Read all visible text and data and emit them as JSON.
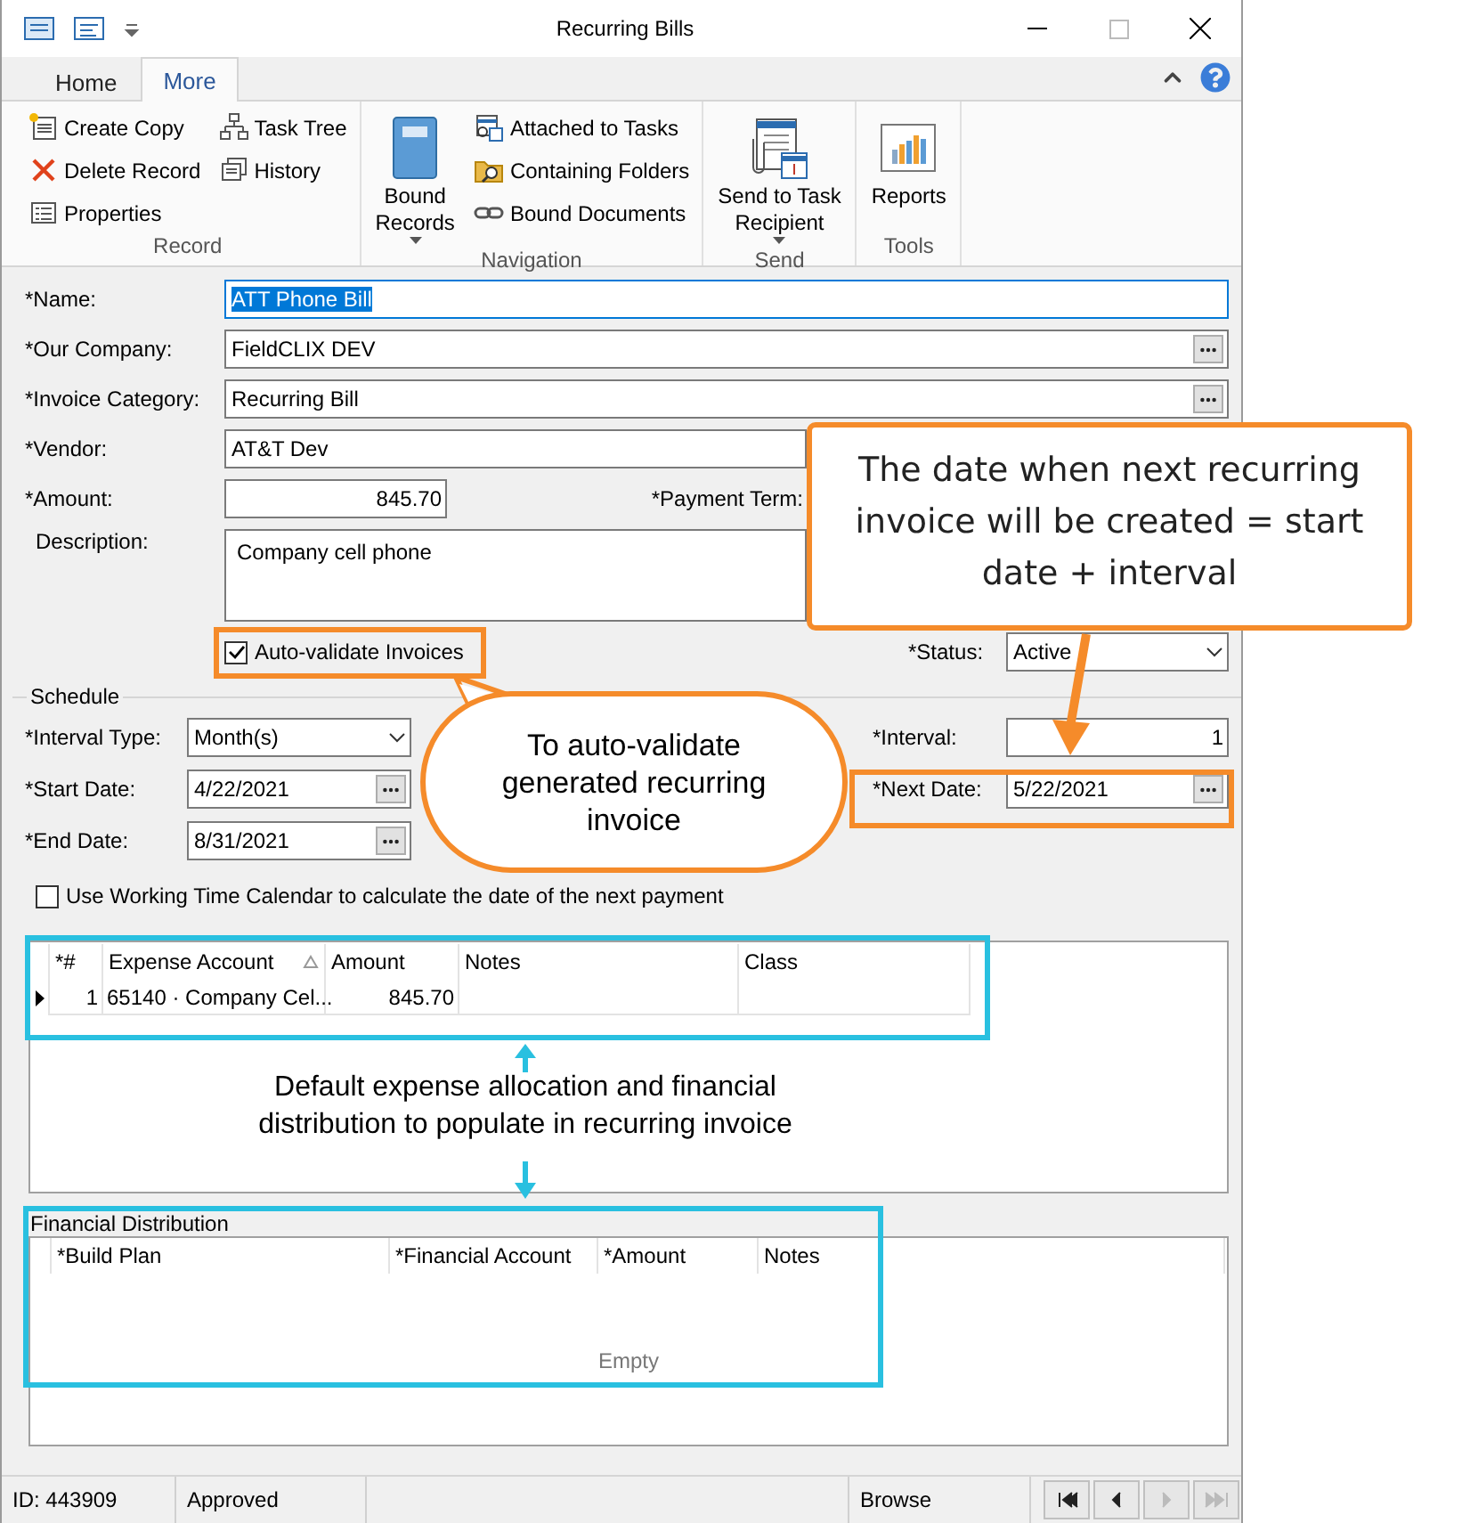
{
  "window": {
    "title": "Recurring Bills"
  },
  "ribbon_tabs": [
    {
      "label": "Home",
      "selected": false
    },
    {
      "label": "More",
      "selected": true
    }
  ],
  "ribbon_groups": [
    {
      "label": "Record",
      "items": [
        {
          "kind": "stack",
          "buttons": [
            {
              "label": "Create Copy"
            },
            {
              "label": "Delete Record"
            },
            {
              "label": "Properties"
            }
          ]
        },
        {
          "kind": "stack",
          "buttons": [
            {
              "label": "Task Tree"
            },
            {
              "label": "History"
            }
          ]
        }
      ]
    },
    {
      "label": "Navigation",
      "items": [
        {
          "kind": "large",
          "lines": [
            "Bound",
            "Records"
          ],
          "dropdown": true
        },
        {
          "kind": "stack",
          "buttons": [
            {
              "label": "Attached to Tasks"
            },
            {
              "label": "Containing Folders"
            },
            {
              "label": "Bound Documents"
            }
          ]
        }
      ]
    },
    {
      "label": "Send",
      "items": [
        {
          "kind": "large",
          "lines": [
            "Send to Task",
            "Recipient"
          ],
          "dropdown": true
        }
      ]
    },
    {
      "label": "Tools",
      "items": [
        {
          "kind": "large",
          "lines": [
            "Reports"
          ],
          "dropdown": false
        }
      ]
    }
  ],
  "form": {
    "name": {
      "label": "*Name:",
      "value": "ATT Phone Bill",
      "text_selected": true
    },
    "our_company": {
      "label": "*Our Company:",
      "value": "FieldCLIX DEV"
    },
    "invoice_category": {
      "label": "*Invoice Category:",
      "value": "Recurring Bill"
    },
    "vendor": {
      "label": "*Vendor:",
      "value": "AT&T Dev"
    },
    "amount": {
      "label": "*Amount:",
      "value": "845.70"
    },
    "payment_term": {
      "label": "*Payment Term:"
    },
    "description": {
      "label": "Description:",
      "value": "Company cell phone"
    },
    "auto_validate": {
      "label": "Auto-validate Invoices",
      "checked": true
    },
    "status": {
      "label": "*Status:",
      "value": "Active"
    }
  },
  "schedule": {
    "title": "Schedule",
    "interval_type": {
      "label": "*Interval Type:",
      "value": "Month(s)"
    },
    "start_date": {
      "label": "*Start Date:",
      "value": "4/22/2021"
    },
    "end_date": {
      "label": "*End Date:",
      "value": "8/31/2021"
    },
    "interval": {
      "label": "*Interval:",
      "value": "1"
    },
    "next_date": {
      "label": "*Next Date:",
      "value": "5/22/2021"
    },
    "working_calendar": {
      "label": "Use Working Time Calendar to calculate the date of the next payment",
      "checked": false
    }
  },
  "expense_grid": {
    "columns": [
      {
        "label": "*#",
        "sorted": false
      },
      {
        "label": "Expense Account",
        "sorted": true
      },
      {
        "label": "Amount",
        "sorted": false
      },
      {
        "label": "Notes",
        "sorted": false
      },
      {
        "label": "Class",
        "sorted": false
      }
    ],
    "rows": [
      {
        "current": true,
        "number": "1",
        "expense_account": "65140 · Company Cel...",
        "amount": "845.70"
      }
    ]
  },
  "financial_distribution": {
    "title": "Financial Distribution",
    "columns": [
      "*Build Plan",
      "*Financial Account",
      "*Amount",
      "Notes"
    ],
    "empty_text": "Empty"
  },
  "status_bar": {
    "id": "ID: 443909",
    "state": "Approved",
    "mode": "Browse",
    "nav_buttons": [
      {
        "disabled": false
      },
      {
        "disabled": false
      },
      {
        "disabled": true
      },
      {
        "disabled": true
      }
    ]
  },
  "annotations": {
    "next_date_note": "The date when next recurring invoice will be created  = start date + interval",
    "auto_validate_note": "To auto-validate generated recurring invoice",
    "grid_note": "Default expense allocation and financial distribution to populate in recurring invoice"
  }
}
